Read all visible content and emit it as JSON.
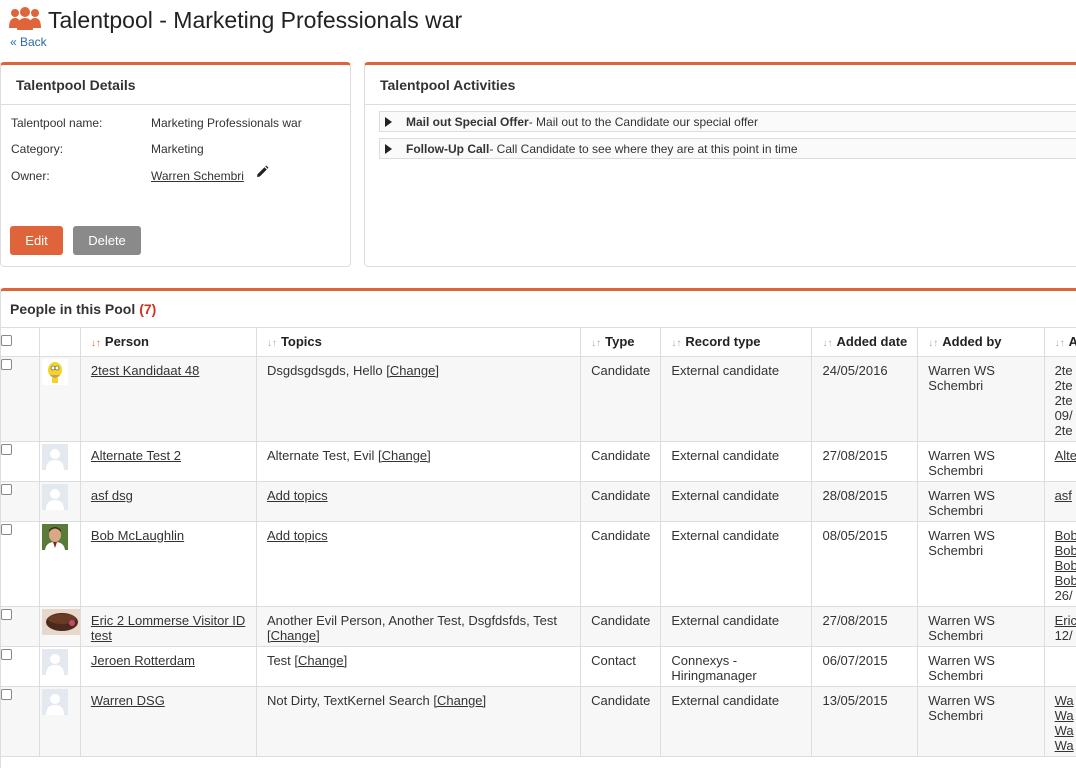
{
  "header": {
    "title": "Talentpool - Marketing Professionals war",
    "back": "« Back"
  },
  "details": {
    "heading": "Talentpool Details",
    "rows": [
      {
        "label": "Talentpool name:",
        "value": "Marketing Professionals war"
      },
      {
        "label": "Category:",
        "value": "Marketing"
      },
      {
        "label": "Owner:",
        "value": "Warren Schembri"
      }
    ],
    "edit_label": "Edit",
    "delete_label": "Delete"
  },
  "activities": {
    "heading": "Talentpool Activities",
    "items": [
      {
        "name": "Mail out Special Offer",
        "desc": " - Mail out to the Candidate our special offer"
      },
      {
        "name": "Follow-Up Call",
        "desc": " - Call Candidate to see where they are at this point in time"
      }
    ]
  },
  "people": {
    "heading": "People in this Pool",
    "count": "(7)",
    "columns": [
      "Person",
      "Topics",
      "Type",
      "Record type",
      "Added date",
      "Added by",
      "A"
    ],
    "rows": [
      {
        "avatar": "homer-avatar",
        "name": "2test Kandidaat 48",
        "topics": "Dsgdsgdsgds, Hello",
        "topics_link": "[Change]",
        "type": "Candidate",
        "record_type": "External candidate",
        "added_date": "24/05/2016",
        "added_by": "Warren WS Schembri",
        "a": [
          "2te",
          "2te",
          "2te",
          "09/",
          "2te"
        ]
      },
      {
        "avatar": "default-avatar",
        "name": "Alternate Test 2",
        "topics": "Alternate Test, Evil",
        "topics_link": "[Change]",
        "type": "Candidate",
        "record_type": "External candidate",
        "added_date": "27/08/2015",
        "added_by": "Warren WS Schembri",
        "a": [
          "Alte"
        ]
      },
      {
        "avatar": "default-avatar",
        "name": "asf dsg",
        "topics": "",
        "topics_link": "Add topics",
        "type": "Candidate",
        "record_type": "External candidate",
        "added_date": "28/08/2015",
        "added_by": "Warren WS Schembri",
        "a": [
          "asf"
        ]
      },
      {
        "avatar": "photo-avatar",
        "name": "Bob McLaughlin",
        "topics": "",
        "topics_link": "Add topics",
        "type": "Candidate",
        "record_type": "External candidate",
        "added_date": "08/05/2015",
        "added_by": "Warren WS Schembri",
        "a": [
          "Bob",
          "Bob",
          "Bob",
          "Bob",
          "26/"
        ]
      },
      {
        "avatar": "cake-avatar",
        "name": "Eric 2 Lommerse Visitor ID test",
        "topics": "Another Evil Person, Another Test, Dsgfdsfds, Test",
        "topics_link": "[Change]",
        "type": "Candidate",
        "record_type": "External candidate",
        "added_date": "27/08/2015",
        "added_by": "Warren WS Schembri",
        "a": [
          "Eric",
          "12/"
        ]
      },
      {
        "avatar": "default-avatar",
        "name": "Jeroen Rotterdam",
        "topics": "Test",
        "topics_link": "[Change]",
        "type": "Contact",
        "record_type": "Connexys - Hiringmanager",
        "added_date": "06/07/2015",
        "added_by": "Warren WS Schembri",
        "a": []
      },
      {
        "avatar": "default-avatar",
        "name": "Warren DSG",
        "topics": "Not Dirty, TextKernel Search",
        "topics_link": "[Change]",
        "type": "Candidate",
        "record_type": "External candidate",
        "added_date": "13/05/2015",
        "added_by": "Warren WS Schembri",
        "a": [
          "Wa",
          "Wa",
          "Wa",
          "Wa"
        ]
      }
    ]
  },
  "colors": {
    "accent": "#e0643a",
    "count": "#d0321e",
    "delete": "#8a8a8a"
  }
}
